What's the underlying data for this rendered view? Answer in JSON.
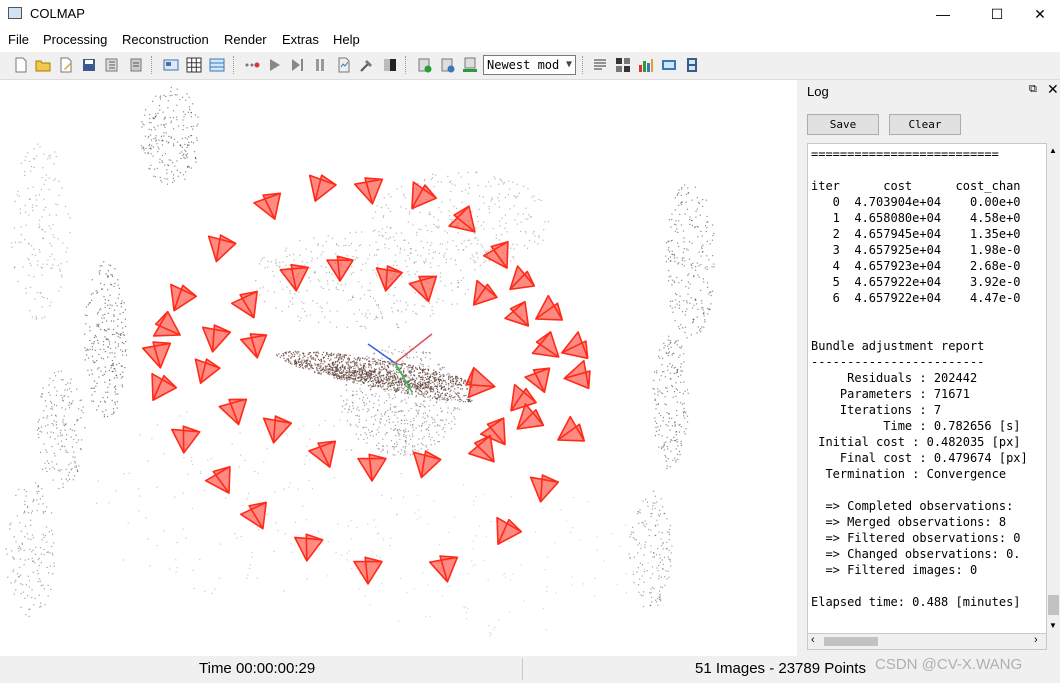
{
  "window": {
    "title": "COLMAP",
    "minimize_glyph": "—",
    "maximize_glyph": "☐",
    "close_glyph": "✕"
  },
  "menu": {
    "items": [
      "File",
      "Processing",
      "Reconstruction",
      "Render",
      "Extras",
      "Help"
    ]
  },
  "toolbar": {
    "model_selector_value": "Newest mod",
    "buttons": [
      "new-project-icon",
      "open-project-icon",
      "edit-project-icon",
      "save-project-icon",
      "import-model-icon",
      "export-model-icon",
      "feature-extraction-icon",
      "feature-matching-icon",
      "database-management-icon",
      "reconstruction-options-icon",
      "start-reconstruction-icon",
      "step-reconstruction-icon",
      "pause-reconstruction-icon",
      "reconstruction-stats-icon",
      "bundle-adjustment-icon",
      "dense-reconstruction-icon",
      "add-model-icon",
      "delete-model-icon",
      "reset-view-icon",
      "render-options-icon",
      "grid-view-icon",
      "bar-chart-icon",
      "snapshot-icon",
      "movie-grabber-icon"
    ]
  },
  "colors": {
    "camera_red": "#ff2a1a",
    "point_dark": "#2e2e2e",
    "track_brown": "#5e3f35"
  },
  "log": {
    "title": "Log",
    "save_label": "Save",
    "clear_label": "Clear",
    "lines": [
      "==========================",
      "",
      "iter      cost      cost_chan",
      "   0  4.703904e+04    0.00e+0",
      "   1  4.658080e+04    4.58e+0",
      "   2  4.657945e+04    1.35e+0",
      "   3  4.657925e+04    1.98e-0",
      "   4  4.657923e+04    2.68e-0",
      "   5  4.657922e+04    3.92e-0",
      "   6  4.657922e+04    4.47e-0",
      "",
      "",
      "Bundle adjustment report",
      "------------------------",
      "     Residuals : 202442",
      "    Parameters : 71671",
      "    Iterations : 7",
      "          Time : 0.782656 [s]",
      " Initial cost : 0.482035 [px]",
      "    Final cost : 0.479674 [px]",
      "  Termination : Convergence",
      "",
      "  => Completed observations:",
      "  => Merged observations: 8",
      "  => Filtered observations: 0",
      "  => Changed observations: 0.",
      "  => Filtered images: 0",
      "",
      "Elapsed time: 0.488 [minutes]"
    ]
  },
  "status": {
    "time": "Time 00:00:00:29",
    "counts": "51 Images - 23789 Points"
  },
  "watermark": "CSDN @CV-X.WANG"
}
